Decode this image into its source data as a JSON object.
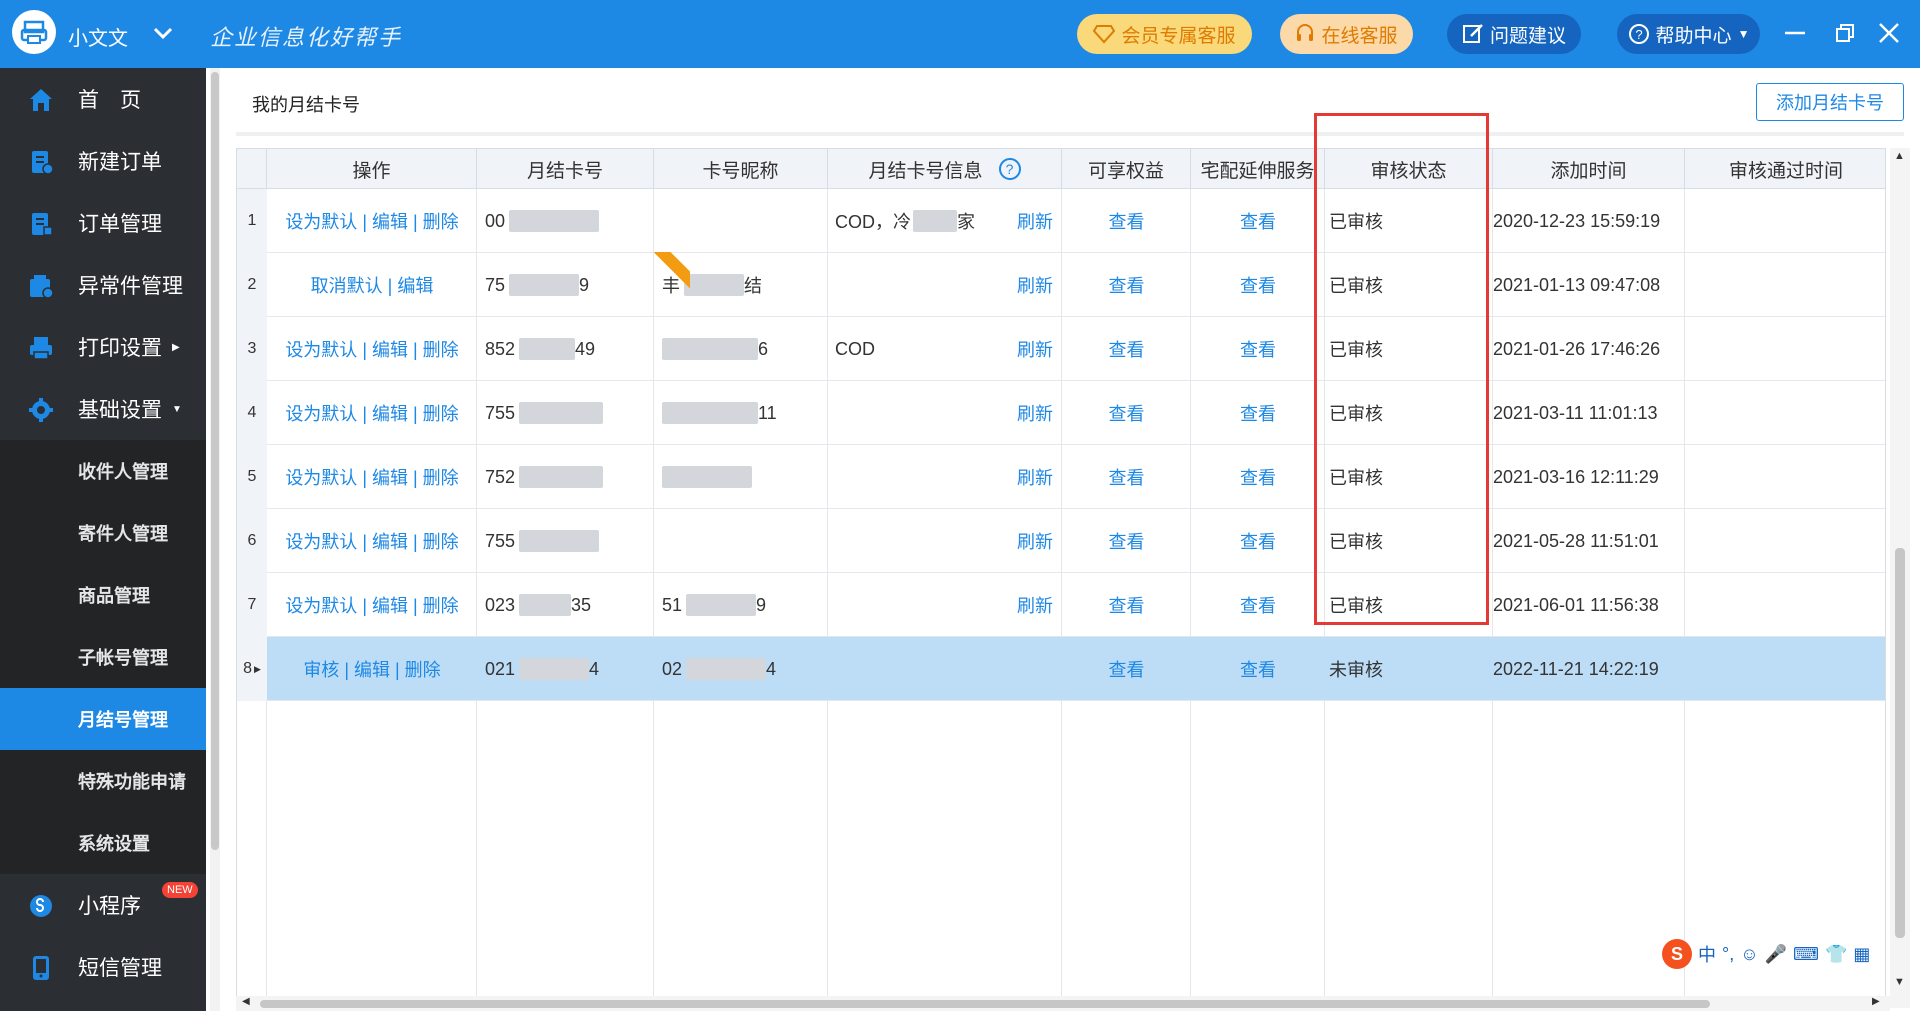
{
  "titlebar": {
    "user_name": "小文文",
    "slogan": "企业信息化好帮手",
    "vip_service": "会员专属客服",
    "online_service": "在线客服",
    "suggestion": "问题建议",
    "help_center": "帮助中心"
  },
  "sidebar": {
    "items": [
      {
        "label": "首　页",
        "icon": "home-icon"
      },
      {
        "label": "新建订单",
        "icon": "new-order-icon"
      },
      {
        "label": "订单管理",
        "icon": "order-icon"
      },
      {
        "label": "异常件管理",
        "icon": "exception-icon"
      },
      {
        "label": "打印设置",
        "icon": "printer-icon"
      },
      {
        "label": "基础设置",
        "icon": "gear-icon"
      }
    ],
    "sub_items": [
      "收件人管理",
      "寄件人管理",
      "商品管理",
      "子帐号管理",
      "月结号管理",
      "特殊功能申请",
      "系统设置"
    ],
    "bottom_items": [
      {
        "label": "小程序",
        "icon": "mini-program-icon",
        "badge": "NEW"
      },
      {
        "label": "短信管理",
        "icon": "sms-icon"
      }
    ]
  },
  "main": {
    "title": "我的月结卡号",
    "add_button": "添加月结卡号"
  },
  "table": {
    "headers": [
      "操作",
      "月结卡号",
      "卡号昵称",
      "月结卡号信息",
      "可享权益",
      "宅配延伸服务",
      "审核状态",
      "添加时间",
      "审核通过时间"
    ],
    "rows": [
      {
        "no": "1",
        "actions": "设为默认 | 编辑 | 删除",
        "card": "00",
        "nick": "",
        "info": "COD，冷",
        "info_tail": "家",
        "refresh": "刷新",
        "rights": "查看",
        "delivery": "查看",
        "status": "已审核",
        "added": "2020-12-23 15:59:19",
        "passed": ""
      },
      {
        "no": "2",
        "actions": "取消默认 | 编辑",
        "card": "75",
        "card_tail": "9",
        "nick": "丰",
        "nick_tail": "结",
        "info": "",
        "refresh": "刷新",
        "rights": "查看",
        "delivery": "查看",
        "status": "已审核",
        "added": "2021-01-13 09:47:08",
        "passed": ""
      },
      {
        "no": "3",
        "actions": "设为默认 | 编辑 | 删除",
        "card": "852",
        "card_tail": "49",
        "nick": "",
        "nick_tail": "6",
        "info": "COD",
        "refresh": "刷新",
        "rights": "查看",
        "delivery": "查看",
        "status": "已审核",
        "added": "2021-01-26 17:46:26",
        "passed": ""
      },
      {
        "no": "4",
        "actions": "设为默认 | 编辑 | 删除",
        "card": "755",
        "nick": "",
        "nick_tail": "11",
        "info": "",
        "refresh": "刷新",
        "rights": "查看",
        "delivery": "查看",
        "status": "已审核",
        "added": "2021-03-11 11:01:13",
        "passed": ""
      },
      {
        "no": "5",
        "actions": "设为默认 | 编辑 | 删除",
        "card": "752",
        "nick": "",
        "info": "",
        "refresh": "刷新",
        "rights": "查看",
        "delivery": "查看",
        "status": "已审核",
        "added": "2021-03-16 12:11:29",
        "passed": ""
      },
      {
        "no": "6",
        "actions": "设为默认 | 编辑 | 删除",
        "card": "755",
        "nick": "",
        "info": "",
        "refresh": "刷新",
        "rights": "查看",
        "delivery": "查看",
        "status": "已审核",
        "added": "2021-05-28 11:51:01",
        "passed": ""
      },
      {
        "no": "7",
        "actions": "设为默认 | 编辑 | 删除",
        "card": "023",
        "card_tail": "35",
        "nick": "51",
        "nick_tail": "9",
        "info": "",
        "refresh": "刷新",
        "rights": "查看",
        "delivery": "查看",
        "status": "已审核",
        "added": "2021-06-01 11:56:38",
        "passed": ""
      },
      {
        "no": "8",
        "actions": "审核 | 编辑 | 删除",
        "card": "021",
        "card_tail": "4",
        "nick": "02",
        "nick_tail": "4",
        "info": "",
        "refresh": "",
        "rights": "查看",
        "delivery": "查看",
        "status": "未审核",
        "added": "2022-11-21 14:22:19",
        "passed": ""
      }
    ]
  },
  "ime": {
    "lang": "中"
  },
  "colors": {
    "brand": "#1E88E5",
    "sidebar": "#2B2F33",
    "highlight": "#E53935",
    "selected_row": "#BDDDF7"
  }
}
